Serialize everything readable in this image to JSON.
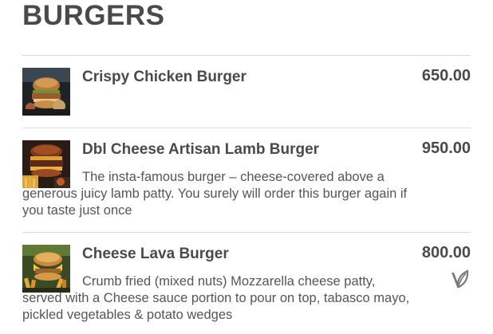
{
  "section": {
    "title": "BURGERS"
  },
  "items": [
    {
      "name": "Crispy Chicken Burger",
      "price": "650.00",
      "description": "",
      "thumbnail_icon": "burger-photo"
    },
    {
      "name": "Dbl Cheese Artisan Lamb Burger",
      "price": "950.00",
      "description": "The insta-famous burger – cheese-covered above a generous juicy lamb patty. You surely will order this burger again if you taste just once",
      "thumbnail_icon": "burger-photo"
    },
    {
      "name": "Cheese Lava Burger",
      "price": "800.00",
      "description": "Crumb fried (mixed nuts) Mozzarella cheese patty, served with a Cheese sauce portion to pour on top, tabasco mayo, pickled vegetables & potato wedges",
      "thumbnail_icon": "burger-photo",
      "badge_icon": "vegetarian-leaf-icon"
    }
  ],
  "colors": {
    "text": "#4a4a4a",
    "divider": "#dcdcdc"
  }
}
